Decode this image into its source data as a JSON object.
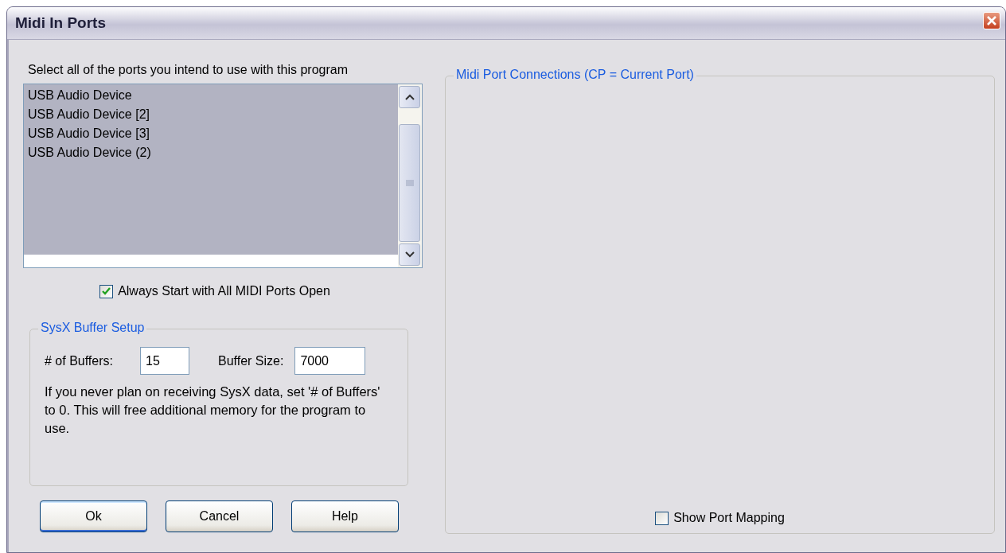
{
  "window": {
    "title": "Midi In Ports"
  },
  "ports": {
    "label": "Select all of the ports you intend to use with this program",
    "items": [
      "USB Audio Device",
      "USB Audio Device [2]",
      "USB Audio Device [3]",
      "USB Audio Device (2)"
    ]
  },
  "always_open": {
    "label": "Always Start with All MIDI Ports Open",
    "checked": true
  },
  "sysx": {
    "title": "SysX Buffer Setup",
    "fields": [
      {
        "label": "# of Buffers:",
        "value": "15"
      },
      {
        "label": "Buffer Size:",
        "value": "7000"
      }
    ],
    "note": "If you never plan on receiving SysX data, set '# of Buffers' to 0. This will free additional memory for the program to use."
  },
  "buttons": [
    "Ok",
    "Cancel",
    "Help"
  ],
  "connections": {
    "title": "Midi Port Connections (CP = Current Port)",
    "show_mapping": {
      "label": "Show Port Mapping",
      "checked": false
    }
  }
}
